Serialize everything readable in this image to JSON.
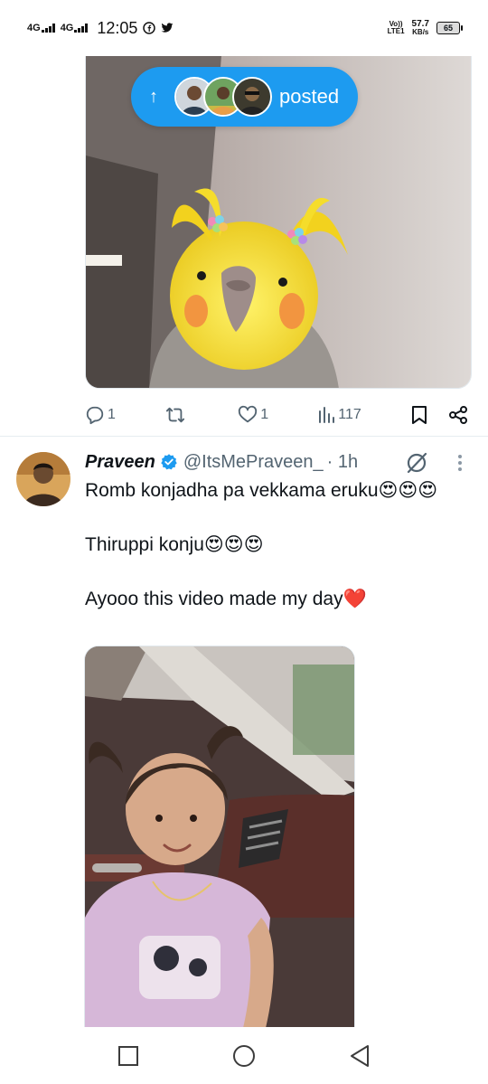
{
  "status_bar": {
    "network1": "4G",
    "network2": "4G",
    "time": "12:05",
    "volte_top": "Vo))",
    "volte_bottom": "LTE1",
    "speed_value": "57.7",
    "speed_unit": "KB/s",
    "battery": "65",
    "icons": [
      "facebook-icon",
      "twitter-icon"
    ]
  },
  "first_tweet": {
    "posted_pill": {
      "arrow": "↑",
      "label": "posted"
    },
    "actions": {
      "replies": "1",
      "retweets": "",
      "likes": "1",
      "views": "117"
    }
  },
  "second_tweet": {
    "name": "Praveen",
    "handle": "@ItsMePraveen_",
    "time": "· 1h",
    "lines": [
      "Romb konjadha pa vekkama eruku😍😍😍",
      "Thiruppi konju😍😍😍",
      "Ayooo this video made my day❤️"
    ]
  },
  "colors": {
    "accent": "#1d9bf0",
    "text_primary": "#0f1419",
    "text_secondary": "#536471"
  },
  "navbar": {
    "icons": [
      "recent-apps-icon",
      "home-icon",
      "back-icon"
    ]
  }
}
